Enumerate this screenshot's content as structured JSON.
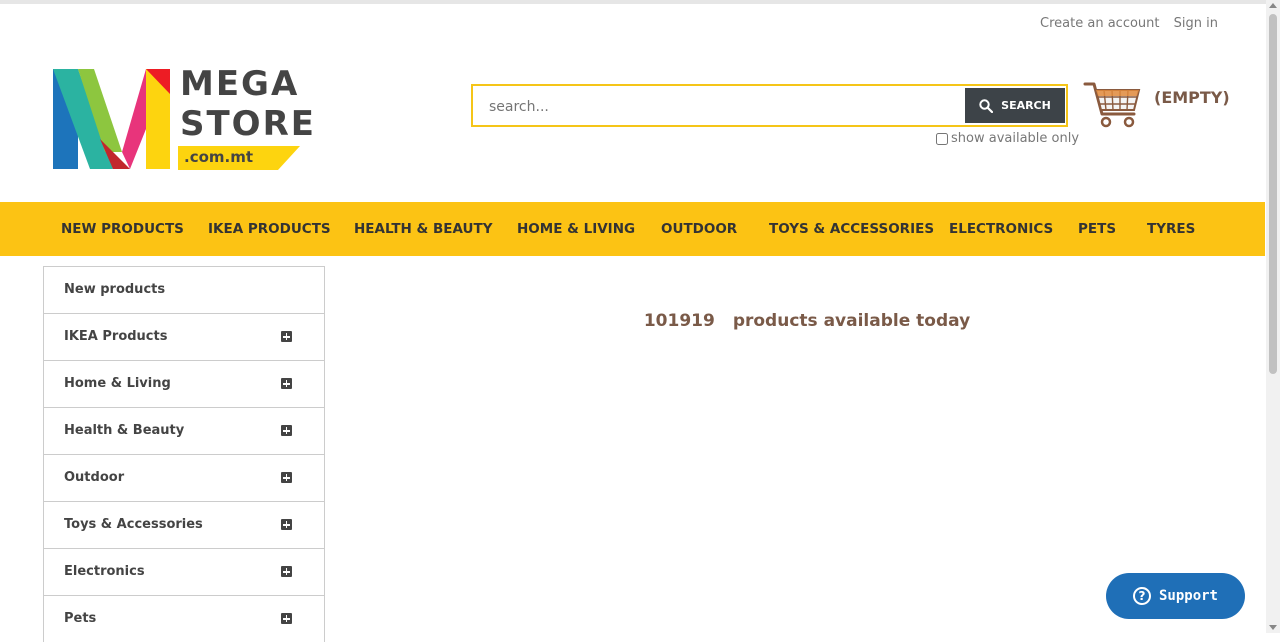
{
  "header": {
    "create_account": "Create an account",
    "sign_in": "Sign in"
  },
  "logo": {
    "line1": "MEGA",
    "line2": "STORE",
    "domain": ".com.mt"
  },
  "search": {
    "placeholder": "search...",
    "button_label": "SEARCH",
    "available_only_label": "show available only",
    "available_only_checked": false
  },
  "cart": {
    "label": "(EMPTY)"
  },
  "nav": {
    "items": [
      "NEW PRODUCTS",
      "IKEA PRODUCTS",
      "HEALTH & BEAUTY",
      "HOME & LIVING",
      "OUTDOOR",
      "TOYS & ACCESSORIES",
      "ELECTRONICS",
      "PETS",
      "TYRES"
    ]
  },
  "sidebar": {
    "items": [
      {
        "label": "New products",
        "expandable": false
      },
      {
        "label": "IKEA Products",
        "expandable": true
      },
      {
        "label": "Home & Living",
        "expandable": true
      },
      {
        "label": "Health & Beauty",
        "expandable": true
      },
      {
        "label": "Outdoor",
        "expandable": true
      },
      {
        "label": "Toys & Accessories",
        "expandable": true
      },
      {
        "label": "Electronics",
        "expandable": true
      },
      {
        "label": "Pets",
        "expandable": true
      }
    ]
  },
  "main": {
    "count": "101919",
    "count_text": "products available today"
  },
  "support": {
    "label": "Support"
  },
  "colors": {
    "nav_bg": "#fcc314",
    "search_border": "#f5c518",
    "search_button": "#3d4348",
    "accent_text": "#7a5a48",
    "support_button": "#1f6fb7"
  }
}
